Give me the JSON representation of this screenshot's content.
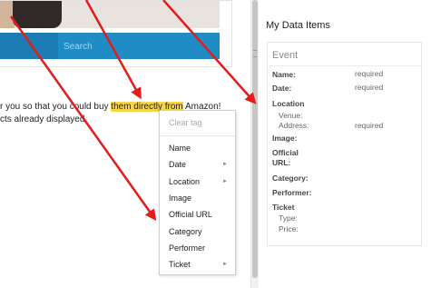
{
  "search": {
    "placeholder": "Search"
  },
  "page_text": {
    "line1_a": "r you so that you could buy ",
    "line1_highlight": "them directly from",
    "line1_b": " Amazon!",
    "line2": "cts already displayed."
  },
  "context_menu": {
    "clear_tag": "Clear tag",
    "items": [
      {
        "label": "Name",
        "submenu": false
      },
      {
        "label": "Date",
        "submenu": true
      },
      {
        "label": "Location",
        "submenu": true
      },
      {
        "label": "Image",
        "submenu": false
      },
      {
        "label": "Official URL",
        "submenu": false
      },
      {
        "label": "Category",
        "submenu": false
      },
      {
        "label": "Performer",
        "submenu": false
      },
      {
        "label": "Ticket",
        "submenu": true
      }
    ],
    "submenu_arrow": "►"
  },
  "panel": {
    "title": "My Data Items",
    "card_title": "Event",
    "fields": {
      "name": "Name:",
      "name_status": "required",
      "date": "Date:",
      "date_status": "required",
      "location": "Location",
      "venue": "Venue:",
      "address": "Address:",
      "address_status": "required",
      "image": "Image:",
      "official": "Official",
      "url": "URL:",
      "category": "Category:",
      "performer": "Performer:",
      "ticket": "Ticket",
      "type": "Type:",
      "price": "Price:"
    }
  },
  "colors": {
    "highlight": "#f7d64a",
    "search_bar": "#1f8cc6",
    "arrow": "#e41b1b"
  }
}
